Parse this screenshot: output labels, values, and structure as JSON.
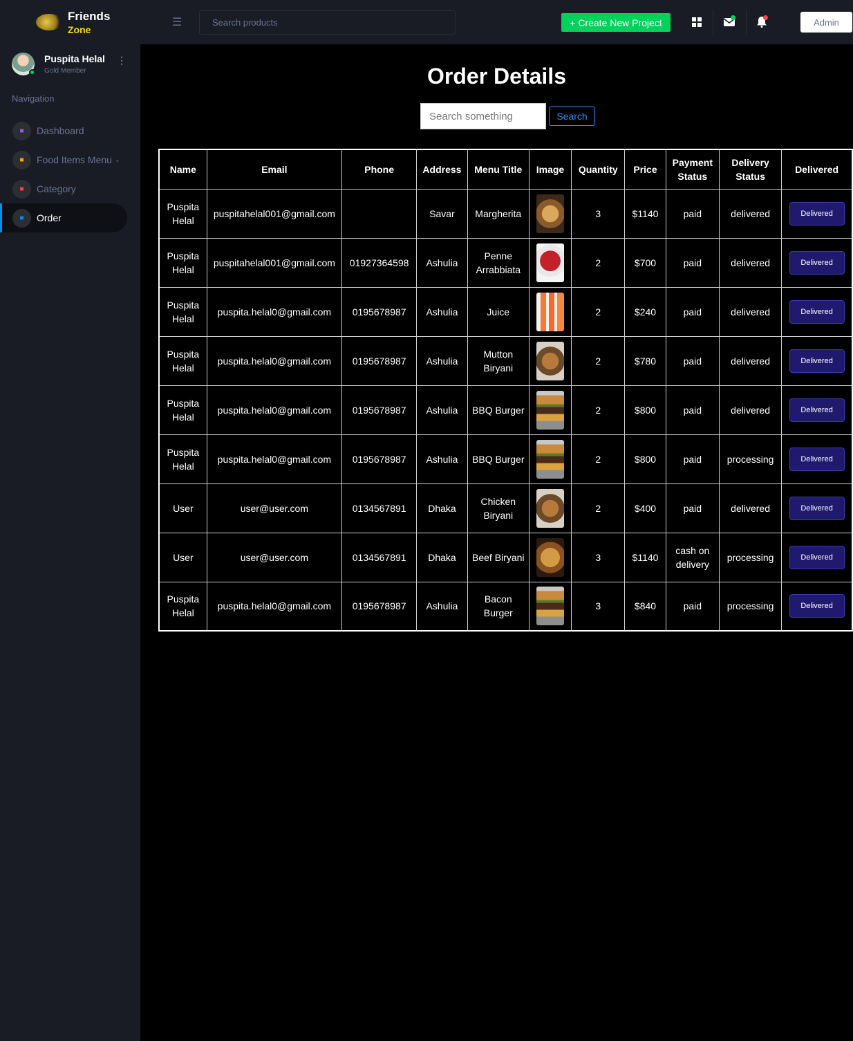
{
  "brand": {
    "name": "Friends",
    "sub": "Zone"
  },
  "profile": {
    "name": "Puspita Helal",
    "role": "Gold Member"
  },
  "nav": {
    "heading": "Navigation",
    "items": [
      {
        "label": "Dashboard",
        "icon": "speedometer-icon",
        "color": "#8f5fe8"
      },
      {
        "label": "Food Items Menu",
        "icon": "laptop-icon",
        "color": "#ffab00"
      },
      {
        "label": "Category",
        "icon": "list-icon",
        "color": "#fc424a"
      },
      {
        "label": "Order",
        "icon": "chat-icon",
        "color": "#0090e7"
      }
    ]
  },
  "topbar": {
    "search_placeholder": "Search products",
    "create_label": "+ Create New Project",
    "admin_label": "Admin"
  },
  "main": {
    "title": "Order Details",
    "search_placeholder": "Search something",
    "search_button": "Search"
  },
  "table": {
    "headers": {
      "name": "Name",
      "email": "Email",
      "phone": "Phone",
      "address": "Address",
      "menu_title": "Menu Title",
      "image": "Image",
      "quantity": "Quantity",
      "price": "Price",
      "payment_status": "Payment Status",
      "delivery_status": "Delivery Status",
      "delivered": "Delivered"
    },
    "rows": [
      {
        "name": "Puspita Helal",
        "email": "puspitahelal001@gmail.com",
        "phone": "",
        "address": "Savar",
        "menu": "Margherita",
        "image": "pizza",
        "qty": "3",
        "price": "$1140",
        "payment": "paid",
        "delivery": "delivered",
        "action": "Delivered"
      },
      {
        "name": "Puspita Helal",
        "email": "puspitahelal001@gmail.com",
        "phone": "01927364598",
        "address": "Ashulia",
        "menu": "Penne Arrabbiata",
        "image": "pasta",
        "qty": "2",
        "price": "$700",
        "payment": "paid",
        "delivery": "delivered",
        "action": "Delivered"
      },
      {
        "name": "Puspita Helal",
        "email": "puspita.helal0@gmail.com",
        "phone": "0195678987",
        "address": "Ashulia",
        "menu": "Juice",
        "image": "juice",
        "qty": "2",
        "price": "$240",
        "payment": "paid",
        "delivery": "delivered",
        "action": "Delivered"
      },
      {
        "name": "Puspita Helal",
        "email": "puspita.helal0@gmail.com",
        "phone": "0195678987",
        "address": "Ashulia",
        "menu": "Mutton Biryani",
        "image": "biryani",
        "qty": "2",
        "price": "$780",
        "payment": "paid",
        "delivery": "delivered",
        "action": "Delivered"
      },
      {
        "name": "Puspita Helal",
        "email": "puspita.helal0@gmail.com",
        "phone": "0195678987",
        "address": "Ashulia",
        "menu": "BBQ Burger",
        "image": "burger",
        "qty": "2",
        "price": "$800",
        "payment": "paid",
        "delivery": "delivered",
        "action": "Delivered"
      },
      {
        "name": "Puspita Helal",
        "email": "puspita.helal0@gmail.com",
        "phone": "0195678987",
        "address": "Ashulia",
        "menu": "BBQ Burger",
        "image": "burger",
        "qty": "2",
        "price": "$800",
        "payment": "paid",
        "delivery": "processing",
        "action": "Delivered"
      },
      {
        "name": "User",
        "email": "user@user.com",
        "phone": "0134567891",
        "address": "Dhaka",
        "menu": "Chicken Biryani",
        "image": "biryani",
        "qty": "2",
        "price": "$400",
        "payment": "paid",
        "delivery": "delivered",
        "action": "Delivered"
      },
      {
        "name": "User",
        "email": "user@user.com",
        "phone": "0134567891",
        "address": "Dhaka",
        "menu": "Beef Biryani",
        "image": "beef-biryani",
        "qty": "3",
        "price": "$1140",
        "payment": "cash on delivery",
        "delivery": "processing",
        "action": "Delivered"
      },
      {
        "name": "Puspita Helal",
        "email": "puspita.helal0@gmail.com",
        "phone": "0195678987",
        "address": "Ashulia",
        "menu": "Bacon Burger",
        "image": "burger",
        "qty": "3",
        "price": "$840",
        "payment": "paid",
        "delivery": "processing",
        "action": "Delivered"
      }
    ]
  }
}
